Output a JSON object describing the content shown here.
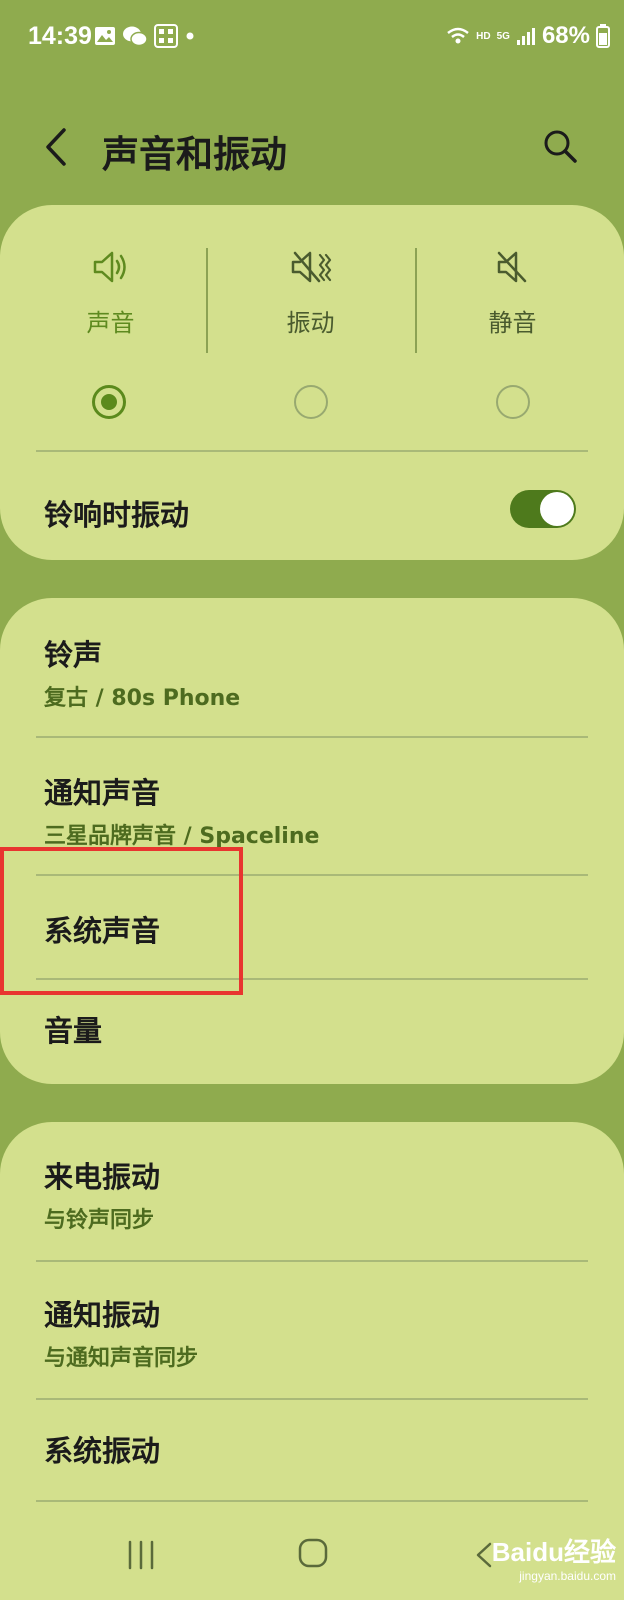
{
  "status_bar": {
    "time": "14:39",
    "battery": "68%",
    "hd_label": "HD",
    "network_label": "5G"
  },
  "header": {
    "title": "声音和振动"
  },
  "sound_mode": {
    "options": [
      {
        "label": "声音",
        "icon": "speaker-icon",
        "selected": true
      },
      {
        "label": "振动",
        "icon": "vibrate-icon",
        "selected": false
      },
      {
        "label": "静音",
        "icon": "mute-icon",
        "selected": false
      }
    ],
    "vibrate_while_ringing": {
      "label": "铃响时振动",
      "enabled": true
    }
  },
  "sound_settings": {
    "items": [
      {
        "title": "铃声",
        "subtitle": "复古 / 80s Phone"
      },
      {
        "title": "通知声音",
        "subtitle": "三星品牌声音 / Spaceline"
      },
      {
        "title": "系统声音"
      },
      {
        "title": "音量"
      }
    ]
  },
  "vibration_settings": {
    "items": [
      {
        "title": "来电振动",
        "subtitle": "与铃声同步"
      },
      {
        "title": "通知振动",
        "subtitle": "与通知声音同步"
      },
      {
        "title": "系统振动"
      }
    ]
  },
  "watermark": {
    "brand": "Baidu经验",
    "url": "jingyan.baidu.com"
  },
  "colors": {
    "background": "#8fab4e",
    "card": "#d3e08d",
    "accent": "#5b8a1c",
    "highlight": "#e8352f"
  }
}
